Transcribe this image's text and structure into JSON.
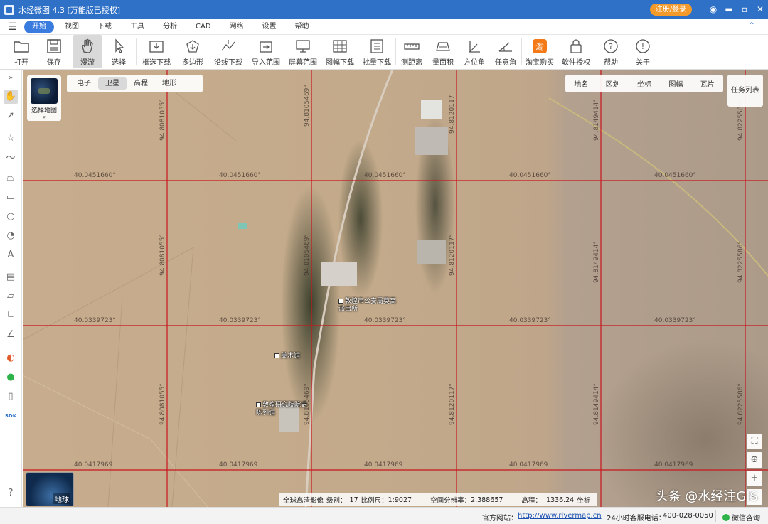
{
  "window": {
    "title": "水经微图 4.3 [万能版已授权]",
    "register_label": "注册/登录"
  },
  "menu": {
    "items": [
      "开始",
      "视图",
      "下载",
      "工具",
      "分析",
      "CAD",
      "网络",
      "设置",
      "帮助"
    ],
    "active_index": 0
  },
  "ribbon": {
    "buttons": [
      {
        "label": "打开",
        "icon": "folder-icon"
      },
      {
        "label": "保存",
        "icon": "save-icon"
      },
      {
        "label": "漫游",
        "icon": "hand-icon",
        "active": true
      },
      {
        "label": "选择",
        "icon": "cursor-icon"
      },
      {
        "label": "框选下载",
        "icon": "box-download-icon"
      },
      {
        "label": "多边形",
        "icon": "polygon-download-icon"
      },
      {
        "label": "沿线下载",
        "icon": "line-download-icon"
      },
      {
        "label": "导入范围",
        "icon": "import-range-icon"
      },
      {
        "label": "屏幕范围",
        "icon": "screen-range-icon"
      },
      {
        "label": "图幅下载",
        "icon": "sheet-download-icon"
      },
      {
        "label": "批量下载",
        "icon": "batch-download-icon"
      },
      {
        "label": "测距离",
        "icon": "ruler-icon"
      },
      {
        "label": "量面积",
        "icon": "area-icon"
      },
      {
        "label": "方位角",
        "icon": "azimuth-icon"
      },
      {
        "label": "任意角",
        "icon": "angle-icon"
      },
      {
        "label": "淘宝购买",
        "icon": "taobao-icon"
      },
      {
        "label": "软件授权",
        "icon": "lock-icon"
      },
      {
        "label": "帮助",
        "icon": "help-icon"
      },
      {
        "label": "关于",
        "icon": "info-icon"
      }
    ]
  },
  "map": {
    "layer_tabs": [
      "电子",
      "卫星",
      "高程",
      "地形"
    ],
    "active_layer": 1,
    "select_map_label": "选择地图",
    "right_tabs": [
      "地名",
      "区划",
      "坐标",
      "图幅",
      "瓦片"
    ],
    "task_list_label": "任务列表",
    "globe_label": "地球",
    "grid_labels": {
      "lat_row1": [
        "40.0451660°",
        "40.0451660°",
        "40.0451660°",
        "40.0451660°",
        "40.0451660°"
      ],
      "lat_row2": [
        "40.0339723°",
        "40.0339723°",
        "40.0339723°",
        "40.0339723°",
        "40.0339723°"
      ],
      "lat_row3": [
        "40.0417969",
        "40.0417969",
        "40.0417969",
        "40.0417969",
        "40.0417969"
      ],
      "lon_cols": [
        "94.8081055°",
        "94.8105469°",
        "94.8120117°",
        "94.8149414°",
        "94.8225586°"
      ],
      "lon_top_col3": "94.8120117"
    },
    "pois": [
      {
        "name": "敦煌市公安局莫高派出所"
      },
      {
        "name": "美术馆"
      },
      {
        "name": "敦煌研究院院史陈列馆"
      }
    ],
    "status": {
      "imagery": "全球高清影像",
      "level_label": "级别：",
      "level": "17",
      "scale_label": "比例尺：",
      "scale": "1:9027",
      "resolution_label": "空间分辨率：",
      "resolution": "2.388657",
      "elevation_label": "高程：",
      "elevation": "1336.24",
      "coord_label": "坐标"
    },
    "watermark": "头条 @水经注GIS"
  },
  "statusbar": {
    "website_label": "官方网站：",
    "website_url": "http://www.rivermap.cn",
    "hotline_label": "24小时客服电话：",
    "hotline": "400-028-0050",
    "wechat_label": "微信咨询"
  }
}
